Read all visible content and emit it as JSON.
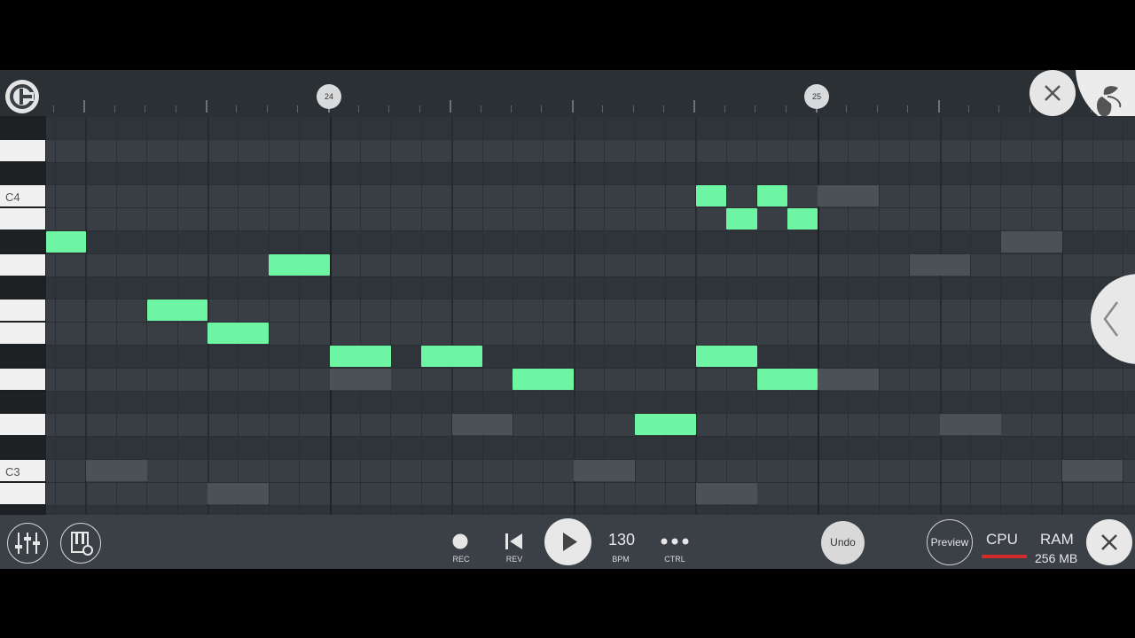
{
  "timeline": {
    "bar_markers": [
      "24",
      "25"
    ]
  },
  "keyboard": {
    "labels": [
      "C4",
      "C3"
    ]
  },
  "transport": {
    "rec_label": "REC",
    "rev_label": "REV",
    "bpm_value": "130",
    "bpm_label": "BPM",
    "ctrl_label": "CTRL",
    "undo_label": "Undo",
    "preview_label": "Preview"
  },
  "status": {
    "cpu_label": "CPU",
    "ram_label": "RAM",
    "ram_value": "256 MB"
  },
  "icons": {
    "logo": "app-logo-icon",
    "close_top": "close-icon",
    "fl_corner": "fruit-logo-icon",
    "side_toggle": "chevron-left-icon",
    "mixer": "mixer-icon",
    "piano_settings": "piano-settings-icon",
    "record": "record-icon",
    "rewind": "skip-back-icon",
    "play": "play-icon",
    "more": "more-icon",
    "close_bottom": "close-icon"
  },
  "colors": {
    "note": "#6ef5a4",
    "ghost_note": "#4a5258",
    "cpu_meter": "#d22b2b",
    "background": "#2e3338"
  },
  "notes": [
    {
      "row": 5,
      "start_step": 0,
      "length": 1.3
    },
    {
      "row": 6,
      "start_step": 7.3,
      "length": 2
    },
    {
      "row": 8,
      "start_step": 3.3,
      "length": 2
    },
    {
      "row": 9,
      "start_step": 5.3,
      "length": 2
    },
    {
      "row": 10,
      "start_step": 9.3,
      "length": 2
    },
    {
      "row": 10,
      "start_step": 12.3,
      "length": 2
    },
    {
      "row": 11,
      "start_step": 15.3,
      "length": 2
    },
    {
      "row": 13,
      "start_step": 19.3,
      "length": 2
    },
    {
      "row": 3,
      "start_step": 21.3,
      "length": 1
    },
    {
      "row": 4,
      "start_step": 22.3,
      "length": 1
    },
    {
      "row": 3,
      "start_step": 23.3,
      "length": 1
    },
    {
      "row": 4,
      "start_step": 24.3,
      "length": 1
    },
    {
      "row": 10,
      "start_step": 21.3,
      "length": 2
    },
    {
      "row": 11,
      "start_step": 23.3,
      "length": 2
    }
  ],
  "ghost_notes": [
    {
      "row": 11,
      "start_step": 9.3,
      "length": 2
    },
    {
      "row": 13,
      "start_step": 13.3,
      "length": 2
    },
    {
      "row": 15,
      "start_step": 1.3,
      "length": 2
    },
    {
      "row": 16,
      "start_step": 5.3,
      "length": 2
    },
    {
      "row": 15,
      "start_step": 17.3,
      "length": 2
    },
    {
      "row": 16,
      "start_step": 21.3,
      "length": 2
    },
    {
      "row": 3,
      "start_step": 25.3,
      "length": 2
    },
    {
      "row": 6,
      "start_step": 28.3,
      "length": 2
    },
    {
      "row": 5,
      "start_step": 31.3,
      "length": 2
    },
    {
      "row": 11,
      "start_step": 25.3,
      "length": 2
    },
    {
      "row": 13,
      "start_step": 29.3,
      "length": 2
    },
    {
      "row": 15,
      "start_step": 33.3,
      "length": 2
    }
  ]
}
